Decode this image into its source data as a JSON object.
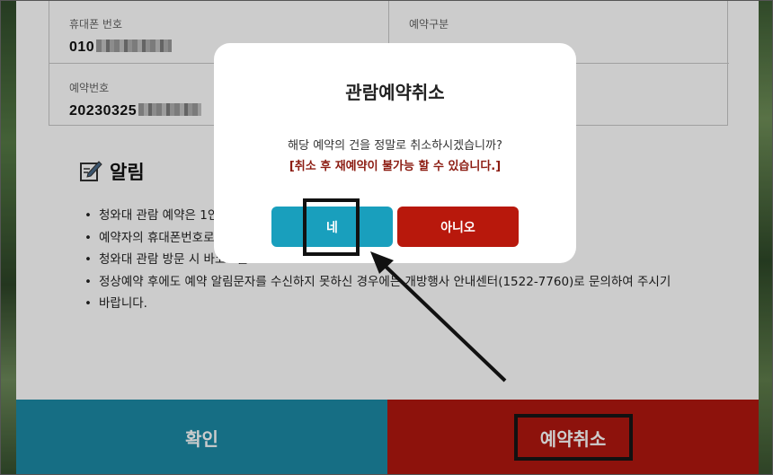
{
  "reservation_info": {
    "phone_label": "휴대폰 번호",
    "phone_value": "010",
    "type_label": "예약구분",
    "number_label": "예약번호",
    "number_value": "20230325"
  },
  "notice": {
    "title": "알림",
    "items": [
      "청와대 관람 예약은 1인",
      "예약자의 휴대폰번호로",
      "청와대 관람 방문 시 바코드를",
      "정상예약 후에도 예약 알림문자를 수신하지 못하신 경우에는 개방행사 안내센터(1522-7760)로 문의하여 주시기",
      "바랍니다."
    ]
  },
  "bottom_buttons": {
    "confirm": "확인",
    "cancel_reservation": "예약취소"
  },
  "modal": {
    "title": "관람예약취소",
    "message": "해당 예약의 건을 정말로 취소하시겠습니까?",
    "warning": "[취소 후 재예약이 불가능 할 수 있습니다.]",
    "yes_label": "네",
    "no_label": "아니오"
  },
  "colors": {
    "teal": "#1c8aa6",
    "red": "#b1170f",
    "warning_text": "#8c1c12"
  }
}
